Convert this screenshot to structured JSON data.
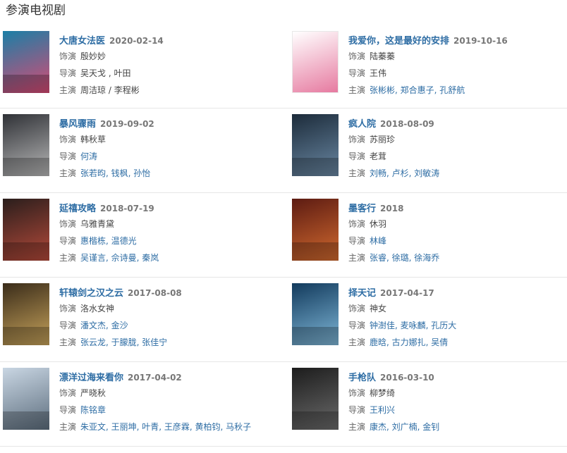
{
  "section_title": "参演电视剧",
  "items": [
    {
      "title": "大唐女法医",
      "date": "2020-02-14",
      "role_label": "饰演",
      "role": "殷妙妙",
      "director_label": "导演",
      "directors": "吴天戈 , 叶田",
      "cast_label": "主演",
      "cast": "周洁琼 / 李程彬",
      "poster_colors": [
        "#1a7fa6",
        "#d94a74"
      ]
    },
    {
      "title": "我爱你，这是最好的安排",
      "date": "2019-10-16",
      "role_label": "饰演",
      "role": "陆蓁蓁",
      "director_label": "导演",
      "directors": "王伟",
      "cast_label": "主演",
      "cast": "张彬彬, 郑合惠子, 孔舒航",
      "poster_colors": [
        "#ffffff",
        "#e67aa0"
      ]
    },
    {
      "title": "暴风骤雨",
      "date": "2019-09-02",
      "role_label": "饰演",
      "role": "韩秋草",
      "director_label": "导演",
      "directors": "何涛",
      "cast_label": "主演",
      "cast": "张若昀, 钱枫, 孙怡",
      "poster_colors": [
        "#2f3136",
        "#b9b9b9"
      ]
    },
    {
      "title": "疯人院",
      "date": "2018-08-09",
      "role_label": "饰演",
      "role": "苏丽珍",
      "director_label": "导演",
      "directors": "老茸",
      "cast_label": "主演",
      "cast": "刘畅, 卢杉, 刘敏涛",
      "poster_colors": [
        "#1c2b3a",
        "#6a88a3"
      ]
    },
    {
      "title": "延禧攻略",
      "date": "2018-07-19",
      "role_label": "饰演",
      "role": "乌雅青黛",
      "director_label": "导演",
      "directors": "惠楷栋, 温德光",
      "cast_label": "主演",
      "cast": "吴谨言, 佘诗曼, 秦岚",
      "poster_colors": [
        "#2a1e1c",
        "#b54a3a"
      ]
    },
    {
      "title": "墨客行",
      "date": "2018",
      "role_label": "饰演",
      "role": "休羽",
      "director_label": "导演",
      "directors": "林峰",
      "cast_label": "主演",
      "cast": "张睿, 徐璐, 徐海乔",
      "poster_colors": [
        "#5c1b12",
        "#d26a2f"
      ]
    },
    {
      "title": "轩辕剑之汉之云",
      "date": "2017-08-08",
      "role_label": "饰演",
      "role": "洛水女神",
      "director_label": "导演",
      "directors": "潘文杰, 金沙",
      "cast_label": "主演",
      "cast": "张云龙, 于朦胧, 张佳宁",
      "poster_colors": [
        "#3a2c1a",
        "#c7a35b"
      ]
    },
    {
      "title": "择天记",
      "date": "2017-04-17",
      "role_label": "饰演",
      "role": "神女",
      "director_label": "导演",
      "directors": "钟澍佳, 麦咏麟, 孔历大",
      "cast_label": "主演",
      "cast": "鹿晗, 古力娜扎, 吴倩",
      "poster_colors": [
        "#123a5c",
        "#7fb7d8"
      ]
    },
    {
      "title": "漂洋过海来看你",
      "date": "2017-04-02",
      "role_label": "饰演",
      "role": "严晓秋",
      "director_label": "导演",
      "directors": "陈铭章",
      "cast_label": "主演",
      "cast": "朱亚文, 王丽坤, 叶青, 王彦霖, 黄柏钧, 马秋子",
      "poster_colors": [
        "#c9d6e3",
        "#5d6e7e"
      ]
    },
    {
      "title": "手枪队",
      "date": "2016-03-10",
      "role_label": "饰演",
      "role": "柳梦绮",
      "director_label": "导演",
      "directors": "王利兴",
      "cast_label": "主演",
      "cast": "康杰, 刘广楠, 金钊",
      "poster_colors": [
        "#1c1c1c",
        "#6b6b6b"
      ]
    }
  ]
}
